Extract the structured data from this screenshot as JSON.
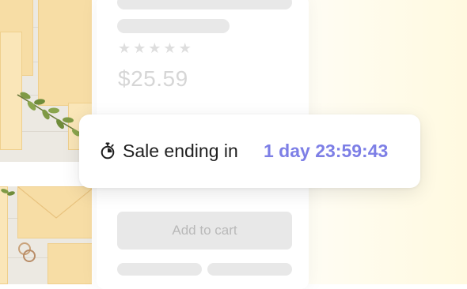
{
  "product": {
    "rating_stars": [
      "★",
      "★",
      "★",
      "★",
      "★"
    ],
    "price": "$25.59",
    "add_to_cart_label": "Add to cart"
  },
  "sale_banner": {
    "icon": "stopwatch-icon",
    "label": "Sale ending in",
    "countdown": "1 day 23:59:43",
    "accent_color": "#7d7fe6"
  }
}
